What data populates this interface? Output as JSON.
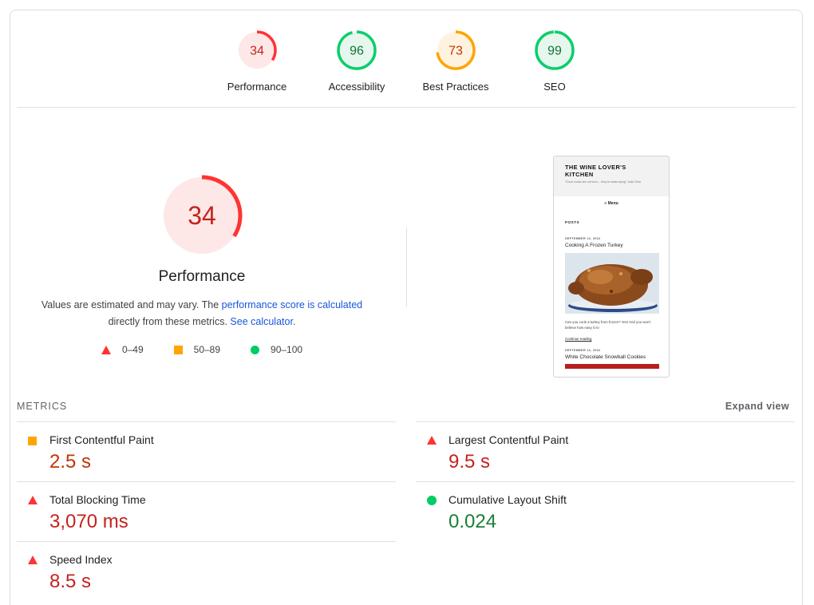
{
  "gauges": [
    {
      "score": "34",
      "label": "Performance",
      "value": 34,
      "color": "#ff3333",
      "bg": "#fde8e7",
      "text_color": "#c5221f"
    },
    {
      "score": "96",
      "label": "Accessibility",
      "value": 96,
      "color": "#0cce6b",
      "bg": "#e6f7ee",
      "text_color": "#137333"
    },
    {
      "score": "73",
      "label": "Best Practices",
      "value": 73,
      "color": "#ffa400",
      "bg": "#fff3e0",
      "text_color": "#c33300"
    },
    {
      "score": "99",
      "label": "SEO",
      "value": 99,
      "color": "#0cce6b",
      "bg": "#e6f7ee",
      "text_color": "#137333"
    }
  ],
  "performance": {
    "score": "34",
    "value": 34,
    "title": "Performance",
    "desc_prefix": "Values are estimated and may vary. The ",
    "desc_link1": "performance score is calculated",
    "desc_mid": " directly from these metrics. ",
    "desc_link2": "See calculator",
    "desc_suffix": "."
  },
  "legend": [
    {
      "shape": "triangle",
      "range": "0–49"
    },
    {
      "shape": "square",
      "range": "50–89"
    },
    {
      "shape": "circle",
      "range": "90–100"
    }
  ],
  "screenshot": {
    "site_title_line1": "THE WINE LOVER'S",
    "site_title_line2": "KITCHEN",
    "tagline": "\"Good cooks are not born… they're made trying\" Julia Child",
    "menu": "≡ Menu",
    "posts_label": "POSTS",
    "post1_date": "SEPTEMBER 12, 2022",
    "post1_title": "Cooking A Frozen Turkey",
    "post1_excerpt": "Can you cook a turkey from frozen? Yes! And you won't believe how easy it is!",
    "continue": "Continue reading",
    "post2_date": "SEPTEMBER 12, 2022",
    "post2_title": "White Chocolate Snowball Cookies"
  },
  "metrics_section": {
    "title": "METRICS",
    "expand": "Expand view"
  },
  "metrics_left": [
    {
      "name": "First Contentful Paint",
      "value": "2.5 s",
      "status": "average"
    },
    {
      "name": "Total Blocking Time",
      "value": "3,070 ms",
      "status": "fail"
    },
    {
      "name": "Speed Index",
      "value": "8.5 s",
      "status": "fail"
    }
  ],
  "metrics_right": [
    {
      "name": "Largest Contentful Paint",
      "value": "9.5 s",
      "status": "fail"
    },
    {
      "name": "Cumulative Layout Shift",
      "value": "0.024",
      "status": "pass"
    }
  ]
}
